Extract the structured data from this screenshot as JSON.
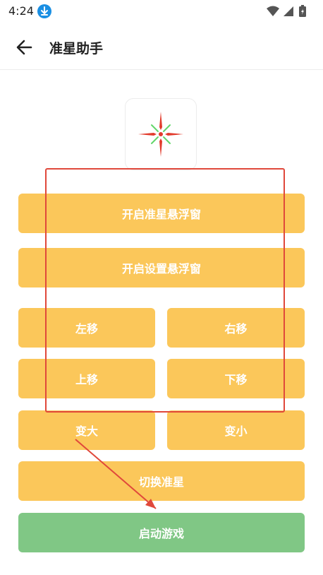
{
  "status_bar": {
    "time": "4:24",
    "download_icon": "download-icon",
    "wifi_icon": "wifi-icon",
    "signal_icon": "signal-icon",
    "battery_icon": "battery-charging-icon"
  },
  "app_bar": {
    "back_icon": "arrow-left-icon",
    "title": "准星助手"
  },
  "preview": {
    "icon": "crosshair-icon",
    "colors": {
      "red": "#e23b2c",
      "green": "#62d66a"
    }
  },
  "buttons": {
    "open_crosshair_float": "开启准星悬浮窗",
    "open_settings_float": "开启设置悬浮窗",
    "move_left": "左移",
    "move_right": "右移",
    "move_up": "上移",
    "move_down": "下移",
    "bigger": "变大",
    "smaller": "变小",
    "switch_crosshair": "切换准星",
    "launch_game": "启动游戏"
  },
  "colors": {
    "button_yellow": "#fbc75a",
    "button_green": "#80c785",
    "annotation_red": "#e0483b"
  }
}
